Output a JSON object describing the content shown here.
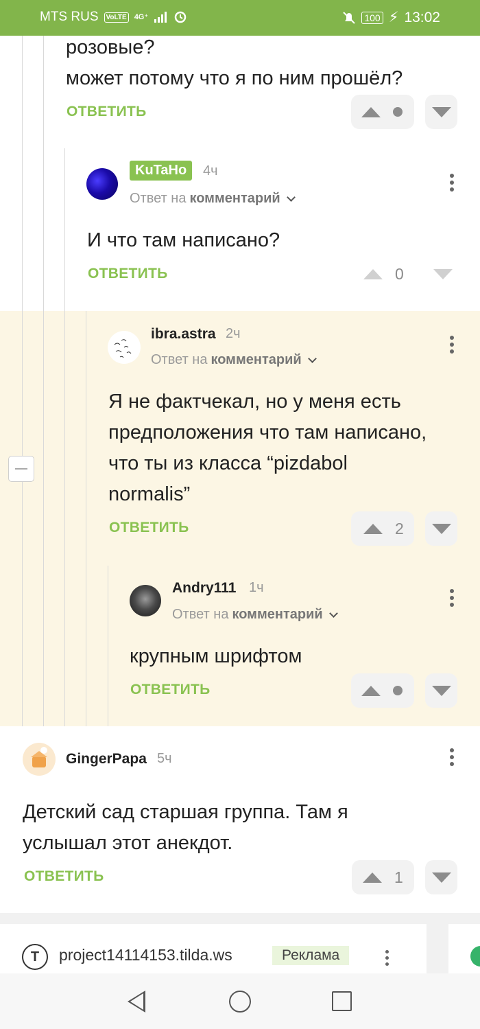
{
  "status_bar": {
    "carrier": "MTS RUS",
    "volte": "VoLTE",
    "network": "4G⁺",
    "battery": "100",
    "time": "13:02"
  },
  "comments": [
    {
      "lines": [
        "розовые?",
        "может потому что я по ним прошёл?"
      ],
      "reply_label": "ОТВЕТИТЬ",
      "votes": "•"
    },
    {
      "author": "KuTaHo",
      "time": "4ч",
      "reply_to_prefix": "Ответ на",
      "reply_to_target": "комментарий",
      "lines": [
        "И что там написано?"
      ],
      "reply_label": "ОТВЕТИТЬ",
      "votes": "0"
    },
    {
      "author": "ibra.astra",
      "time": "2ч",
      "reply_to_prefix": "Ответ на",
      "reply_to_target": "комментарий",
      "lines": [
        "Я не фактчекал, но у меня есть",
        "предположения что там написано,",
        "что ты из класса “pizdabol",
        "normalis”"
      ],
      "reply_label": "ОТВЕТИТЬ",
      "votes": "2"
    },
    {
      "author": "Andry111",
      "time": "1ч",
      "reply_to_prefix": "Ответ на",
      "reply_to_target": "комментарий",
      "lines": [
        "крупным шрифтом"
      ],
      "reply_label": "ОТВЕТИТЬ",
      "votes": "•"
    },
    {
      "author": "GingerPapa",
      "time": "5ч",
      "lines": [
        "Детский сад старшая группа. Там я",
        "услышал этот анекдот."
      ],
      "reply_label": "ОТВЕТИТЬ",
      "votes": "1"
    }
  ],
  "ad": {
    "site": "project14114153.tilda.ws",
    "label": "Реклама"
  },
  "icons": {
    "upvote": "upvote-icon",
    "downvote": "downvote-icon",
    "more": "more-vertical-icon",
    "chevron": "chevron-down-icon",
    "collapse": "collapse-thread-icon",
    "back": "nav-back-icon",
    "home": "nav-home-icon",
    "recents": "nav-recents-icon"
  },
  "colors": {
    "brand_green": "#82b54b",
    "highlight_bg": "#fcf6e4"
  }
}
